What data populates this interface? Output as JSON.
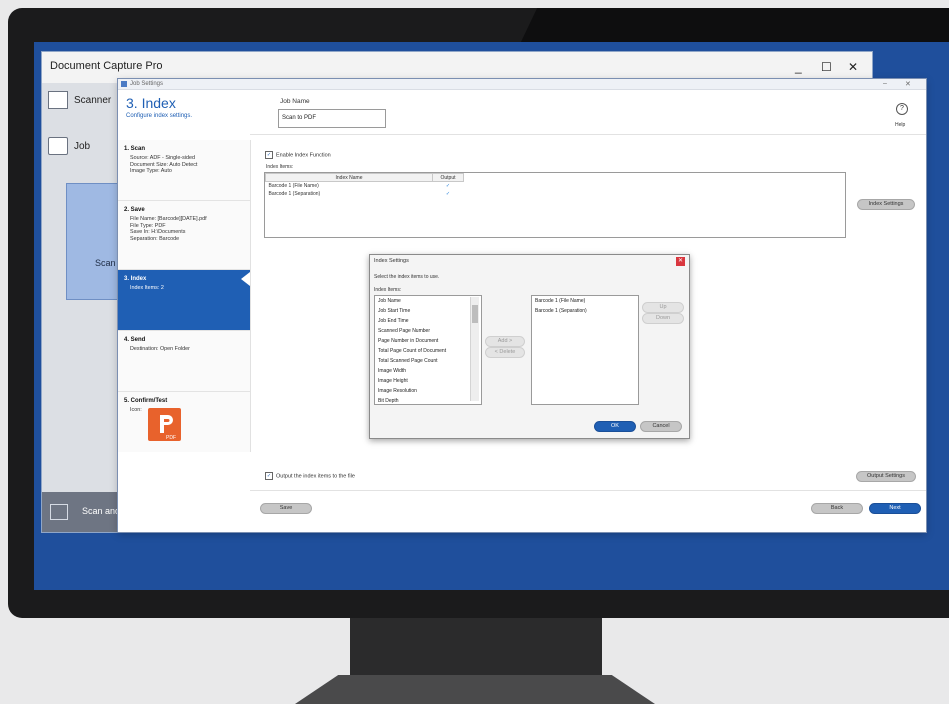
{
  "app": {
    "title": "Document Capture Pro",
    "window_controls": [
      "_",
      "☐",
      "✕"
    ],
    "left_nav": {
      "scanner_label": "Scanner",
      "job_label": "Job",
      "scan_tile_label": "Scan",
      "scan_bottom_label": "Scan and"
    }
  },
  "job_dialog": {
    "title": "Job Settings",
    "header_title": "3. Index",
    "header_subtitle": "Configure index settings.",
    "job_name_label": "Job Name",
    "job_name_value": "Scan to PDF",
    "help_label": "Help",
    "steps": [
      {
        "title": "1. Scan",
        "desc": "Source: ADF - Single-sided\nDocument Size: Auto Detect\nImage Type: Auto"
      },
      {
        "title": "2. Save",
        "desc": "File Name: [Barcode][DATE].pdf\nFile Type: PDF\nSave In: H:\\Documents\nSeparation: Barcode"
      },
      {
        "title": "3. Index",
        "desc": "Index Items: 2"
      },
      {
        "title": "4. Send",
        "desc": "Destination: Open Folder"
      },
      {
        "title": "5. Confirm/Test",
        "desc": "Icon:"
      }
    ],
    "enable_index_label": "Enable Index Function",
    "index_items_label": "Index Items:",
    "table_headers": [
      "Index Name",
      "Output"
    ],
    "table_rows": [
      {
        "name": "Barcode 1 (File Name)",
        "output": "✓"
      },
      {
        "name": "Barcode 1 (Separation)",
        "output": "✓"
      }
    ],
    "index_settings_button": "Index Settings",
    "output_index_label": "Output the index items to the file",
    "output_settings_button": "Output Settings",
    "save_button": "Save",
    "back_button": "Back",
    "next_button": "Next"
  },
  "index_popup": {
    "title": "Index Settings",
    "instruction": "Select the index items to use.",
    "items_label": "Index Items:",
    "available_items": [
      "Job Name",
      "Job Start Time",
      "Job End Time",
      "Scanned Page Number",
      "Page Number in Document",
      "Total Page Count of Document",
      "Total Scanned Page Count",
      "Image Width",
      "Image Height",
      "Image Resolution",
      "Bit Depth"
    ],
    "selected_items": [
      "Barcode 1 (File Name)",
      "Barcode 1 (Separation)"
    ],
    "add_button": "Add >",
    "remove_button": "< Delete",
    "up_button": "Up",
    "down_button": "Down",
    "ok_button": "OK",
    "cancel_button": "Cancel"
  },
  "colors": {
    "accent": "#1f5fb4",
    "screen_bg": "#1f4f9c"
  }
}
